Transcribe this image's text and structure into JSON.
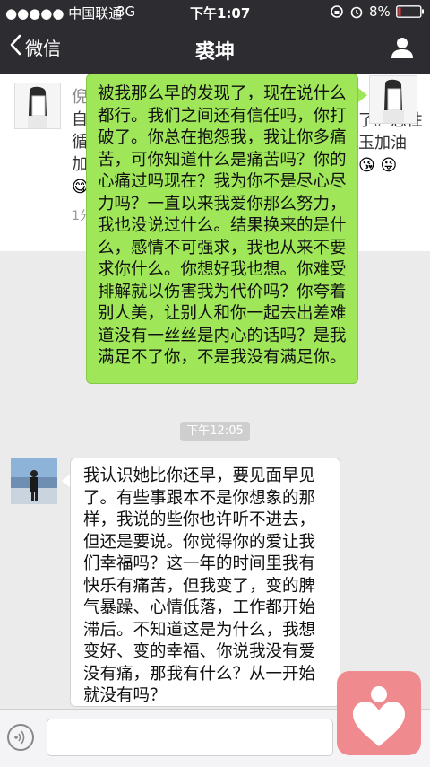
{
  "status_bar": {
    "signal": "●●●●● 中国联通",
    "network": "3G",
    "time": "下午1:07",
    "battery": "8%"
  },
  "nav": {
    "back_label": "微信",
    "title": "裘坤"
  },
  "card": {
    "line1": "倪",
    "line2": "自",
    "line3": "循",
    "line4": "加",
    "time": "1分",
    "right_line1": "了。恶性",
    "right_line2": "玉加油"
  },
  "messages": {
    "sent": "被我那么早的发现了，现在说什么都行。我们之间还有信任吗，你打破了。你总在抱怨我，我让你多痛苦，可你知道什么是痛苦吗？你的心痛过吗现在？我为你不是尽心尽力吗？一直以来我爱你那么努力，我也没说过什么。结果换来的是什么，感情不可强求，我也从来不要求你什么。你想好我也想。你难受排解就以伤害我为代价吗？你夸着别人美，让别人和你一起去出差难道没有一丝丝是内心的话吗？是我满足不了你，不是我没有满足你。",
    "timestamp": "下午12:05",
    "received": "我认识她比你还早，要见面早见了。有些事跟本不是你想象的那样，我说的些你也许听不进去，但还是要说。你觉得你的爱让我们幸福吗？这一年的时间里我有快乐有痛苦，但我变了，变的脾气暴躁、心情低落，工作都开始滞后。不知道这是为什么，我想变好、变的幸福、你说我没有爱没有痛，那我有什么？从一开始就没有吗？"
  },
  "icons": {
    "back": "chevron-left-icon",
    "profile": "person-icon",
    "voice": "voice-icon",
    "alarm": "alarm-icon",
    "lock": "rotation-lock-icon",
    "battery": "battery-icon"
  },
  "colors": {
    "bar": "#2d2d31",
    "sent_bubble": "#9fe658",
    "received_bubble": "#ffffff",
    "watermark": "#ef8a8f"
  }
}
